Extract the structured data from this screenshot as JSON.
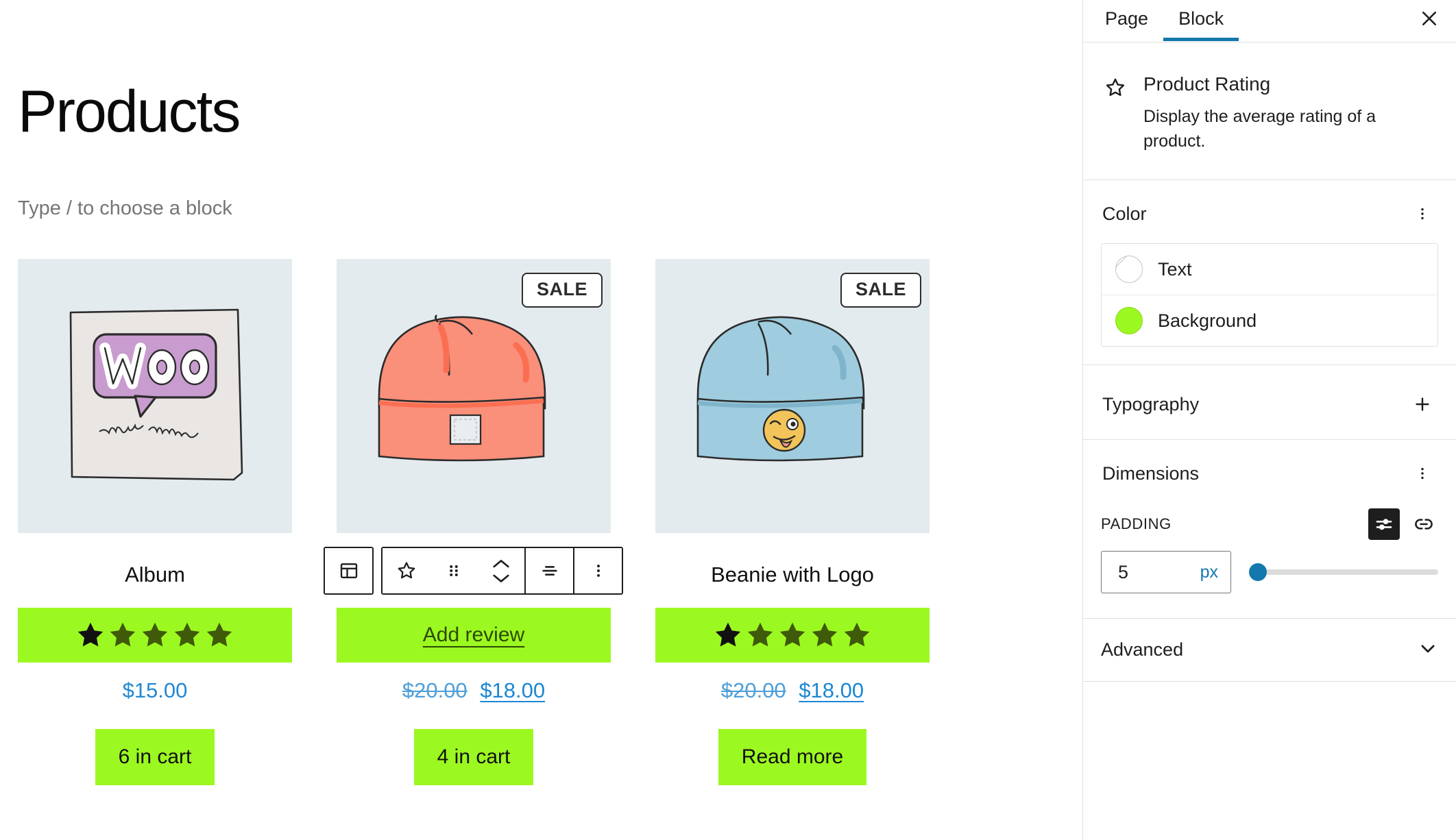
{
  "editor": {
    "page_title": "Products",
    "block_placeholder": "Type / to choose a block"
  },
  "toolbar": {
    "block_type_icon": "layout-block-icon",
    "star_icon": "star-outline-icon",
    "drag_icon": "drag-handle-icon",
    "move_up_icon": "chevron-up-icon",
    "move_down_icon": "chevron-down-icon",
    "align_icon": "align-text-icon",
    "options_icon": "more-vertical-icon"
  },
  "products": [
    {
      "name": "Album",
      "image_alt": "woo-album-cover-art",
      "on_sale": false,
      "sale_label": "",
      "rating_value": 1,
      "rating_max": 5,
      "rating_kind": "stars",
      "add_review_label": "",
      "price_regular": "",
      "price_current": "$15.00",
      "cart_label": "6 in cart"
    },
    {
      "name": "",
      "image_alt": "pink-beanie-illustration",
      "on_sale": true,
      "sale_label": "SALE",
      "rating_value": 0,
      "rating_max": 5,
      "rating_kind": "add-review",
      "add_review_label": "Add review",
      "price_regular": "$20.00",
      "price_current": "$18.00",
      "cart_label": "4 in cart"
    },
    {
      "name": "Beanie with Logo",
      "image_alt": "blue-beanie-with-emoji-logo",
      "on_sale": true,
      "sale_label": "SALE",
      "rating_value": 1,
      "rating_max": 5,
      "rating_kind": "stars",
      "add_review_label": "",
      "price_regular": "$20.00",
      "price_current": "$18.00",
      "cart_label": "Read more"
    }
  ],
  "sidebar": {
    "tabs": [
      {
        "label": "Page",
        "active": false
      },
      {
        "label": "Block",
        "active": true
      }
    ],
    "close_icon": "close-icon",
    "block_card": {
      "icon": "star-outline-icon",
      "title": "Product Rating",
      "description": "Display the average rating of a product."
    },
    "color_section": {
      "title": "Color",
      "options_icon": "more-vertical-icon",
      "rows": [
        {
          "label": "Text",
          "swatch": "none",
          "color": ""
        },
        {
          "label": "Background",
          "swatch": "filled",
          "color": "#9CF821"
        }
      ]
    },
    "typography_section": {
      "title": "Typography",
      "add_icon": "plus-icon"
    },
    "dimensions_section": {
      "title": "Dimensions",
      "options_icon": "more-vertical-icon",
      "padding_label": "PADDING",
      "sides_icon": "sliders-icon",
      "link_icon": "link-icon",
      "padding_value": "5",
      "padding_unit": "px",
      "slider_percent": 2
    },
    "advanced_section": {
      "title": "Advanced",
      "chevron_icon": "chevron-down-icon"
    }
  },
  "colors": {
    "accent_blue": "#1378AD",
    "price_blue": "#2188D4",
    "green_bg": "#9CF821",
    "media_bg": "#E4EBEF",
    "star_filled": "#111111",
    "star_empty": "#3F5A09"
  }
}
